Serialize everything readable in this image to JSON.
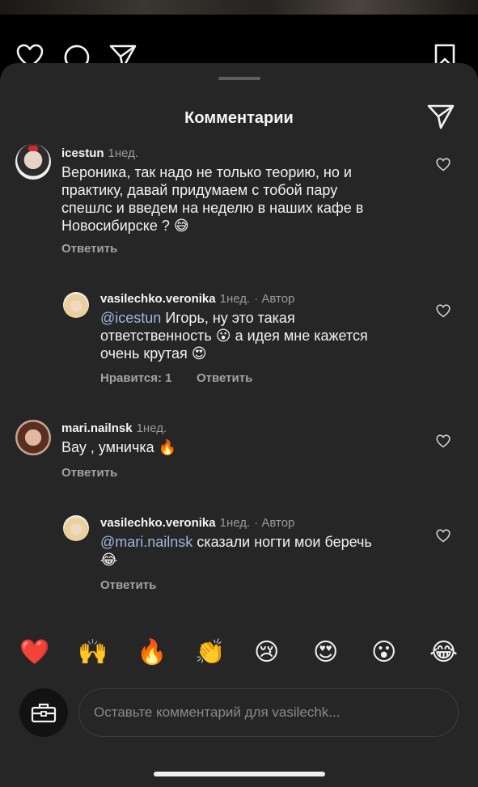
{
  "sheet": {
    "title": "Комментарии"
  },
  "comments": [
    {
      "username": "icestun",
      "time": "1нед.",
      "lines": [
        "Вероника, так надо не только теорию, но и",
        "практику, давай придумаем с тобой пару",
        "спешлс и введем на неделю в наших кафе в",
        "Новосибирске ? 😅"
      ],
      "reply": "Ответить"
    },
    {
      "username": "vasilechko.veronika",
      "time": "1нед.",
      "author": "· Автор",
      "mention": "@icestun",
      "lines": [
        " Игорь, ну это такая",
        "ответственность 😮 а идея мне кажется",
        "очень крутая 😍"
      ],
      "likes": "Нравится: 1",
      "reply": "Ответить"
    },
    {
      "username": "mari.nailnsk",
      "time": "1нед.",
      "lines": [
        "Вау , умничка 🔥"
      ],
      "reply": "Ответить"
    },
    {
      "username": "vasilechko.veronika",
      "time": "1нед.",
      "author": "· Автор",
      "mention": "@mari.nailnsk",
      "lines": [
        " сказали ногти мои беречь",
        "😂"
      ],
      "reply": "Ответить"
    }
  ],
  "reactions": [
    "❤️",
    "🙌",
    "🔥",
    "👏",
    "😢",
    "😍",
    "😮",
    "😂"
  ],
  "composer": {
    "placeholder": "Оставьте комментарий для vasilechk..."
  },
  "icons": {
    "post": [
      "heart-icon",
      "comment-icon",
      "share-icon",
      "bookmark-icon"
    ],
    "like": "heart-outline-icon",
    "share": "paper-plane-icon",
    "compose": "toolbox-icon"
  }
}
